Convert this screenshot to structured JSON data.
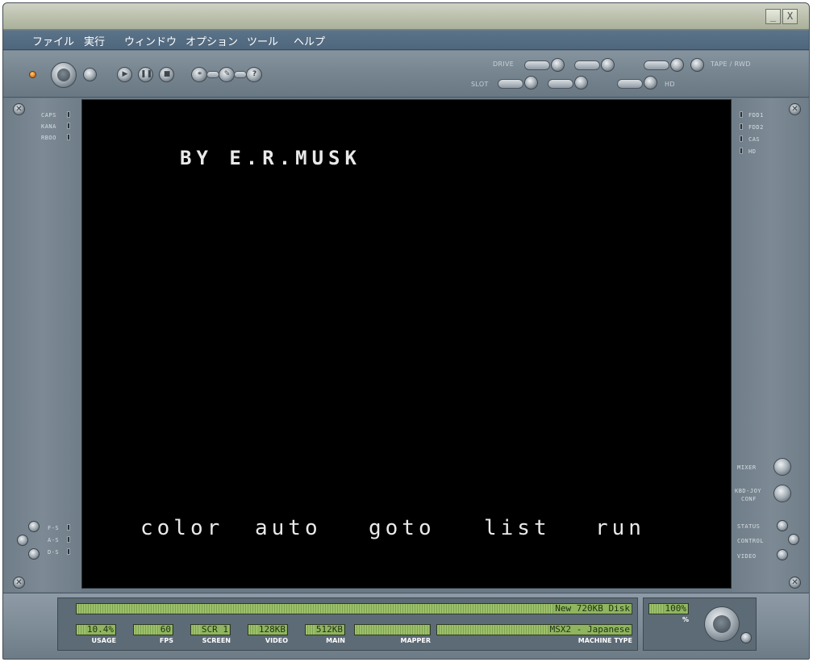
{
  "titlebar": {
    "minimize_glyph": "_",
    "close_glyph": "X"
  },
  "menu": [
    "ファイル",
    "実行",
    "ウィンドウ",
    "オプション",
    "ツール",
    "ヘルプ"
  ],
  "toolbar": {
    "drive_label": "DRIVE",
    "slot_label": "SLOT",
    "tape_label": "TAPE / RWD",
    "hd_label": "HD"
  },
  "left_indicators": [
    "CAPS",
    "KANA",
    "RBOO"
  ],
  "left_bottom_indicators": [
    "F-S",
    "A-S",
    "D-S"
  ],
  "right_indicators": [
    "FDD1",
    "FDD2",
    "CAS",
    "HD"
  ],
  "right_controls": {
    "mixer": "MIXER",
    "kbd_joy": "KBD-JOY",
    "conf": "CONF",
    "status": "STATUS",
    "control": "CONTROL",
    "video": "VIDEO"
  },
  "screen": {
    "credit": "BY E.R.MUSK",
    "function_keys": [
      "color",
      "auto",
      "goto",
      "list",
      "run"
    ]
  },
  "status": {
    "disk": "New 720KB Disk",
    "usage": {
      "value": "10.4%",
      "label": "USAGE"
    },
    "fps": {
      "value": "60",
      "label": "FPS"
    },
    "screen": {
      "value": "SCR 1",
      "label": "SCREEN"
    },
    "video": {
      "value": "128KB",
      "label": "VIDEO"
    },
    "main": {
      "value": "512KB",
      "label": "MAIN"
    },
    "mapper": {
      "value": "",
      "label": "MAPPER"
    },
    "machine": {
      "value": "MSX2 - Japanese",
      "label": "MACHINE TYPE"
    },
    "speed": {
      "value": "100%",
      "label": "%"
    }
  }
}
